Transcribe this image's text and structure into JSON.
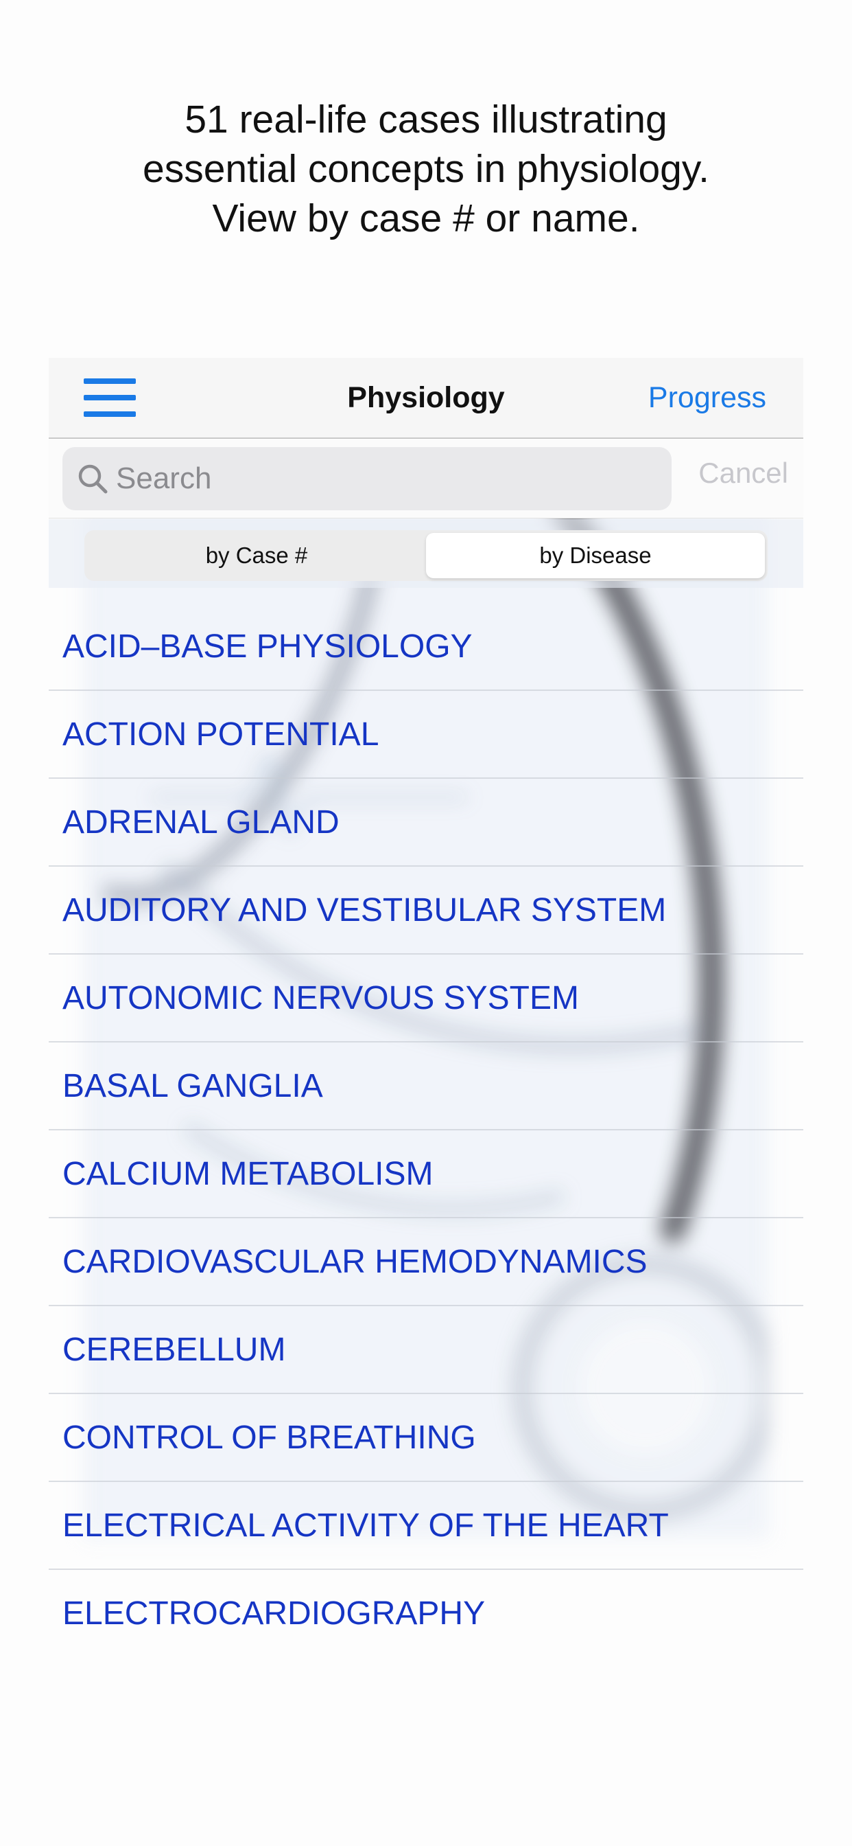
{
  "caption": {
    "line1": "51 real-life cases illustrating",
    "line2": "essential concepts in physiology.",
    "line3": "View by case # or name."
  },
  "navbar": {
    "menu_icon": "hamburger-menu-icon",
    "title": "Physiology",
    "progress_label": "Progress",
    "accent_color": "#1a7ae6"
  },
  "search": {
    "placeholder": "Search",
    "value": "",
    "cancel_label": "Cancel",
    "icon": "search-icon"
  },
  "segments": [
    {
      "label": "by Case #",
      "active": false
    },
    {
      "label": "by Disease",
      "active": true
    }
  ],
  "list": {
    "text_color": "#1535c4",
    "items": [
      "ACID–BASE PHYSIOLOGY",
      "ACTION POTENTIAL",
      "ADRENAL GLAND",
      "AUDITORY AND VESTIBULAR SYSTEM",
      "AUTONOMIC NERVOUS SYSTEM",
      "BASAL GANGLIA",
      "CALCIUM METABOLISM",
      "CARDIOVASCULAR HEMODYNAMICS",
      "CEREBELLUM",
      "CONTROL OF BREATHING",
      "ELECTRICAL ACTIVITY OF THE HEART",
      "ELECTROCARDIOGRAPHY"
    ]
  }
}
